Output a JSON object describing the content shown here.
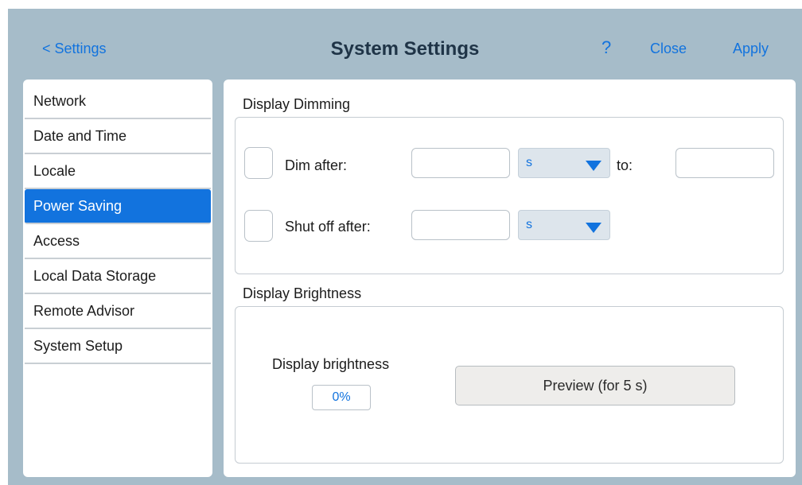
{
  "header": {
    "back_label": "< Settings",
    "title": "System Settings",
    "help_label": "?",
    "close_label": "Close",
    "apply_label": "Apply"
  },
  "sidebar": {
    "items": [
      {
        "label": "Network"
      },
      {
        "label": "Date and Time"
      },
      {
        "label": "Locale"
      },
      {
        "label": "Power Saving"
      },
      {
        "label": "Access"
      },
      {
        "label": "Local Data Storage"
      },
      {
        "label": "Remote Advisor"
      },
      {
        "label": "System Setup"
      }
    ],
    "active_index": 3
  },
  "dimming": {
    "section_title": "Display Dimming",
    "dim_after_label": "Dim after:",
    "dim_after_value": "",
    "dim_unit": "s",
    "to_label": "to:",
    "dim_to_value": "",
    "dim_checked": false,
    "shut_off_label": "Shut off after:",
    "shut_off_value": "",
    "shut_off_unit": "s",
    "shut_off_checked": false
  },
  "brightness": {
    "section_title": "Display Brightness",
    "label": "Display brightness",
    "value": "0%",
    "preview_label": "Preview (for 5 s)"
  },
  "colors": {
    "accent": "#1273de",
    "background": "#a6bcc9",
    "panel": "#ffffff"
  }
}
